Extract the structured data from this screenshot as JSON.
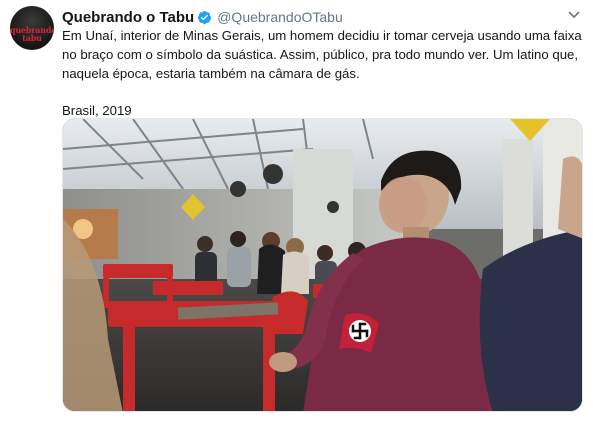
{
  "tweet": {
    "author": {
      "display_name": "Quebrando o Tabu",
      "handle": "@QuebrandoOTabu",
      "avatar_text_line1": "quebrando",
      "avatar_text_line2": "tabu",
      "verified": true
    },
    "text_line1": "Em Unaí, interior de Minas Gerais, um homem decidiu ir tomar cerveja usando uma faixa",
    "text_line2": "no braço com o símbolo da suástica. Assim, público, pra todo mundo ver. Um latino que,",
    "text_line3": "naquela época, estaria também na câmara de gás.",
    "text_line4": "Brasil, 2019",
    "icons": {
      "verified": "verified-badge-icon",
      "menu": "chevron-down-icon"
    },
    "colors": {
      "verified_blue": "#1da1f2",
      "handle_gray": "#657786",
      "text": "#14171a",
      "avatar_text_red": "#d8263a"
    }
  }
}
